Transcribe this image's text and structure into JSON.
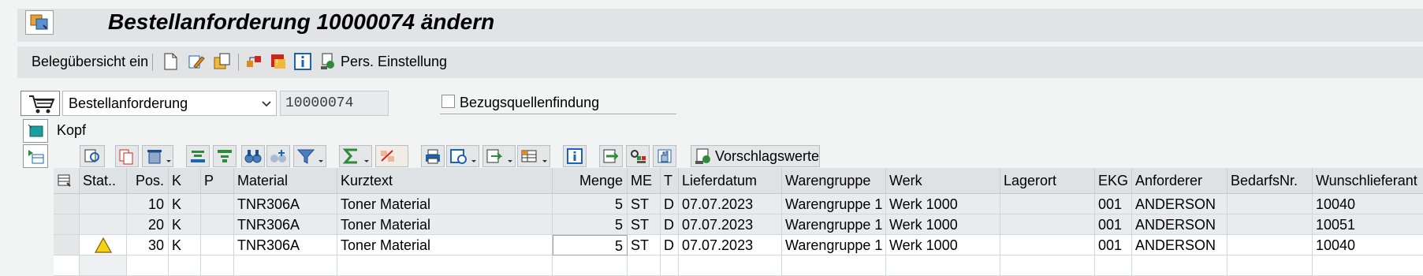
{
  "window": {
    "title": "Bestellanforderung 10000074 ändern"
  },
  "toolbar": {
    "belegubersicht_label": "Belegübersicht ein",
    "pers_einstellung_label": "Pers. Einstellung"
  },
  "header": {
    "doc_type_value": "Bestellanforderung",
    "doc_number": "10000074",
    "bezugsquellen_label": "Bezugsquellenfindung",
    "kopf_label": "Kopf"
  },
  "grid_toolbar": {
    "vorschlagswerte_label": "Vorschlagswerte"
  },
  "grid": {
    "headers": {
      "stat": "Stat..",
      "pos": "Pos.",
      "k": "K",
      "p": "P",
      "material": "Material",
      "kurztext": "Kurztext",
      "menge": "Menge",
      "me": "ME",
      "t": "T",
      "lieferdatum": "Lieferdatum",
      "warengruppe": "Warengruppe",
      "werk": "Werk",
      "lagerort": "Lagerort",
      "ekg": "EKG",
      "anforderer": "Anforderer",
      "bedarfsnr": "BedarfsNr.",
      "wunschlieferant": "Wunschlieferant"
    },
    "rows": [
      {
        "stat": "",
        "pos": "10",
        "k": "K",
        "p": "",
        "material": "TNR306A",
        "kurztext": "Toner Material",
        "menge": "5",
        "me": "ST",
        "t": "D",
        "lieferdatum": "07.07.2023",
        "warengruppe": "Warengruppe 1",
        "werk": "Werk 1000",
        "lagerort": "",
        "ekg": "001",
        "anforderer": "ANDERSON",
        "bedarfsnr": "",
        "wunschlieferant": "10040"
      },
      {
        "stat": "",
        "pos": "20",
        "k": "K",
        "p": "",
        "material": "TNR306A",
        "kurztext": "Toner Material",
        "menge": "5",
        "me": "ST",
        "t": "D",
        "lieferdatum": "07.07.2023",
        "warengruppe": "Warengruppe 1",
        "werk": "Werk 1000",
        "lagerort": "",
        "ekg": "001",
        "anforderer": "ANDERSON",
        "bedarfsnr": "",
        "wunschlieferant": "10051"
      },
      {
        "stat": "warning-icon",
        "pos": "30",
        "k": "K",
        "p": "",
        "material": "TNR306A",
        "kurztext": "Toner Material",
        "menge": "5",
        "me": "ST",
        "t": "D",
        "lieferdatum": "07.07.2023",
        "warengruppe": "Warengruppe 1",
        "werk": "Werk 1000",
        "lagerort": "",
        "ekg": "001",
        "anforderer": "ANDERSON",
        "bedarfsnr": "",
        "wunschlieferant": "10040"
      }
    ]
  },
  "colors": {
    "warning": "#f7d117",
    "icon_blue": "#1d63b3",
    "icon_orange": "#e08a1e",
    "icon_red": "#d0251c",
    "icon_green": "#2e8b3a"
  }
}
